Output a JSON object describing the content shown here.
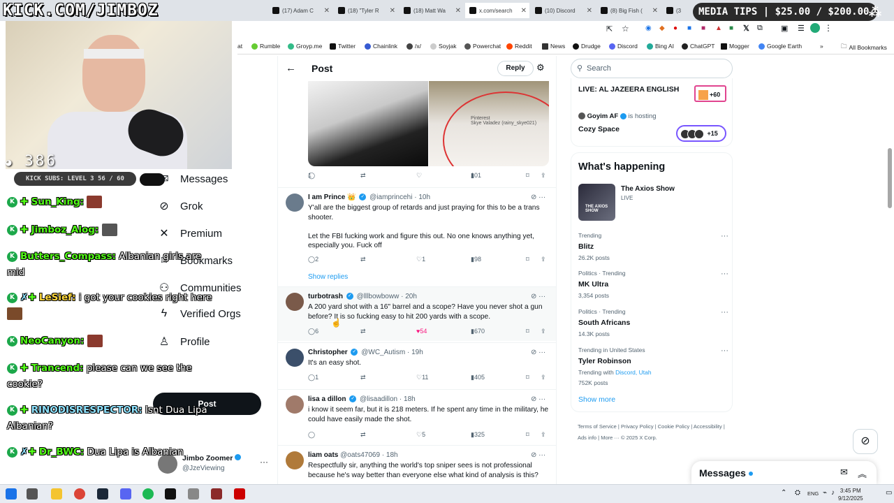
{
  "stream": {
    "kick_url": "KICK.COM/JIMBOZ",
    "viewers": "386",
    "subs_bar": "KICK SUBS: LEVEL 3 56 / 60",
    "media_tips": "MEDIA TIPS | $25.00 / $200.00"
  },
  "browser": {
    "tabs": [
      "(17) Adam C",
      "(18) \"Tyler R",
      "(18) Matt Wa",
      "x.com/search",
      "(10) Discord",
      "(8) Big Fish (",
      "(3"
    ],
    "bookmarks": [
      "at",
      "Rumble",
      "Groyp.me",
      "Twitter",
      "Chainlink",
      "/x/",
      "Soyjak",
      "Powerchat",
      "Reddit",
      "News",
      "Drudge",
      "Discord",
      "Bing AI",
      "ChatGPT",
      "Mogger",
      "Google Earth",
      "All Bookmarks"
    ]
  },
  "nav": {
    "items": [
      "Messages",
      "Grok",
      "Premium",
      "Bookmarks",
      "Communities",
      "Verified Orgs",
      "Profile"
    ],
    "post_button": "Post",
    "me_name": "Jimbo Zoomer",
    "me_handle": "@JzeViewing"
  },
  "chat": [
    {
      "user": "Sun_King:",
      "msg": ""
    },
    {
      "user": "Jimboz_Alog:",
      "msg": ""
    },
    {
      "user": "Butters_Compass:",
      "msg": "Albanian girls are mid"
    },
    {
      "user": "LeSief:",
      "msg": "i got your cookies right here"
    },
    {
      "user": "NeoCanyon:",
      "msg": ""
    },
    {
      "user": "Trancend:",
      "msg": "please can we see the cookie?"
    },
    {
      "user": "RINODISRESPECTOR:",
      "msg": "Isnt Dua Lipa Albanian?"
    },
    {
      "user": "Dr_BWC:",
      "msg": "Dua Lipa is Albanian"
    }
  ],
  "post": {
    "header_title": "Post",
    "reply_button": "Reply",
    "image_caption": "Skye Valadez (rainy_skye021)",
    "image_source": "Pinterest",
    "main_actions": {
      "replies": "1",
      "views": "101"
    },
    "show_replies": "Show replies"
  },
  "tweets": [
    {
      "name": "I am Prince 👑",
      "handle": "@iamprincehi",
      "time": "10h",
      "text": "Y'all are the biggest group of retards and just praying for this to be a trans shooter.\n\nLet the FBI fucking work and figure this out. No one knows anything yet, especially you. Fuck off",
      "replies": "2",
      "retweets": "",
      "likes": "1",
      "views": "98"
    },
    {
      "name": "turbotrash",
      "handle": "@lllbowboww",
      "time": "20h",
      "text": "A 200 yard shot with a 16\" barrel and a scope? Have you never shot a gun before? It is so fucking easy to hit 200 yards with a scope.",
      "replies": "6",
      "retweets": "",
      "likes": "54",
      "views": "670"
    },
    {
      "name": "Christopher",
      "handle": "@WC_Autism",
      "time": "19h",
      "text": "It's an easy shot.",
      "replies": "1",
      "retweets": "",
      "likes": "11",
      "views": "405"
    },
    {
      "name": "lisa a dillon",
      "handle": "@lisaadillon",
      "time": "18h",
      "text": "i know it seem far, but it is 218 meters. If he spent any time in the military, he could have easily made the shot.",
      "replies": "",
      "retweets": "",
      "likes": "5",
      "views": "325"
    },
    {
      "name": "liam oats",
      "handle": "@oats47069",
      "time": "18h",
      "text": "Respectfully sir, anything the world's top sniper sees is not professional because he's way better than everyone else what kind of analysis is this?",
      "replies": "",
      "retweets": "",
      "likes": "",
      "views": ""
    }
  ],
  "sidebar": {
    "search_placeholder": "Search",
    "live1_title": "LIVE: AL JAZEERA ENGLISH",
    "live1_count": "+60",
    "host_name": "Goyim AF",
    "host_label": "is hosting",
    "live2_title": "Cozy Space",
    "live2_count": "+15",
    "happening_title": "What's happening",
    "axios_title": "The Axios Show",
    "axios_status": "LIVE",
    "trends": [
      {
        "context": "Trending",
        "name": "Blitz",
        "posts": "26.2K posts"
      },
      {
        "context": "Politics · Trending",
        "name": "MK Ultra",
        "posts": "3,354 posts"
      },
      {
        "context": "Politics · Trending",
        "name": "South Africans",
        "posts": "14.3K posts"
      },
      {
        "context": "Trending in United States",
        "name": "Tyler Robinson",
        "with_label": "Trending with",
        "with_links": "Discord, Utah",
        "posts": "752K posts"
      }
    ],
    "show_more": "Show more",
    "footer": "Terms of Service  |  Privacy Policy  |  Cookie Policy  |  Accessibility  |  Ads info  |  More ···  © 2025 X Corp.",
    "messages_title": "Messages"
  },
  "taskbar": {
    "lang": "ENG",
    "time": "3:45 PM",
    "date": "9/12/2025"
  }
}
